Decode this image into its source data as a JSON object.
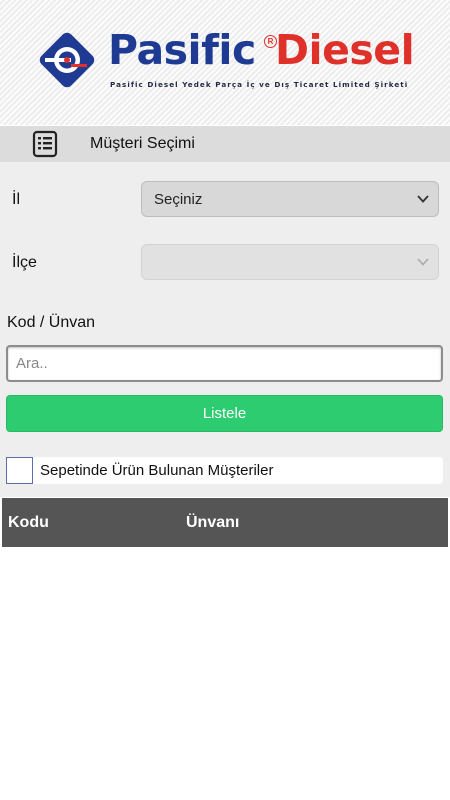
{
  "brand": {
    "name_part1": "Pasific",
    "name_part2": "Diesel",
    "registered_mark": "R",
    "tagline": "Pasific Diesel Yedek Parça İç ve Dış Ticaret Limited Şirketi",
    "colors": {
      "blue": "#1f3a93",
      "red": "#e0302a"
    }
  },
  "titlebar": {
    "icon": "list-icon",
    "title": "Müşteri Seçimi"
  },
  "form": {
    "province": {
      "label": "İl",
      "selected": "Seçiniz"
    },
    "district": {
      "label": "İlçe",
      "selected": ""
    },
    "search": {
      "label": "Kod / Ünvan",
      "placeholder": "Ara..",
      "value": ""
    },
    "list_button": "Listele",
    "basket_filter": {
      "label": "Sepetinde Ürün Bulunan Müşteriler",
      "checked": false
    }
  },
  "table": {
    "columns": [
      "Kodu",
      "Ünvanı"
    ],
    "rows": []
  },
  "colors": {
    "accent_green": "#2ecc71",
    "table_header": "#555555"
  }
}
